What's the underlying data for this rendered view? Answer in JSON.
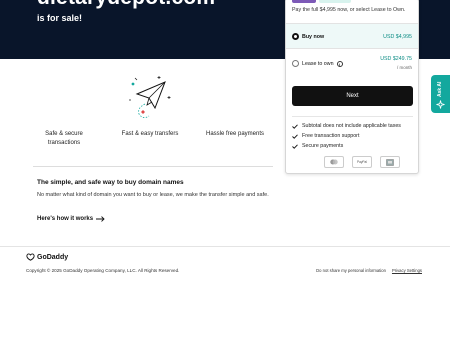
{
  "hero": {
    "domain": "dietarydepot.com",
    "tagline": "is for sale!"
  },
  "features": [
    {
      "label": "Safe & secure transactions"
    },
    {
      "label": "Fast & easy transfers"
    },
    {
      "label": "Hassle free payments"
    }
  ],
  "info": {
    "title": "The simple, and safe way to buy domain names",
    "text": "No matter what kind of domain you want to buy or lease, we make the transfer simple and safe.",
    "link": "Here's how it works"
  },
  "purchase": {
    "subtitle": "Pay the full $4,995 now, or select Lease to Own.",
    "options": [
      {
        "label": "Buy now",
        "price": "USD $4,995",
        "selected": true
      },
      {
        "label": "Lease to own",
        "price": "USD $249.75",
        "period": "/ month",
        "selected": false
      }
    ],
    "next_label": "Next",
    "checks": [
      "Subtotal does not include applicable taxes",
      "Free transaction support",
      "Secure payments"
    ],
    "payment_methods": [
      "card-icon",
      "PayPal",
      "bank-icon"
    ],
    "colors": {
      "accent": "#0d8d85",
      "hero": "#09152a",
      "button": "#111111"
    }
  },
  "ask_ai": {
    "label": "Ask AI"
  },
  "footer": {
    "logo": "GoDaddy",
    "copyright": "Copyright © 2025 GoDaddy Operating Company, LLC. All Rights Reserved.",
    "links": [
      "Do not share my personal information",
      "Privacy Settings"
    ]
  }
}
